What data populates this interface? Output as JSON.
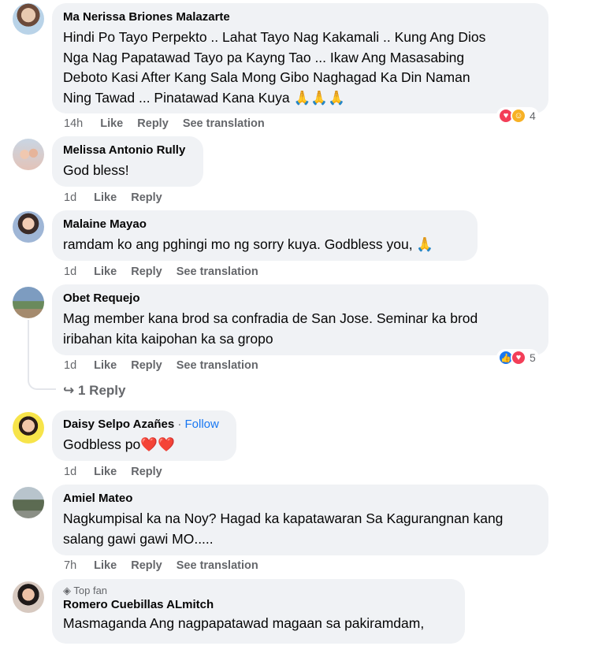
{
  "comments": [
    {
      "author": "Ma Nerissa Briones Malazarte",
      "lines": [
        "Hindi Po Tayo Perpekto .. Lahat Tayo Nag Kakamali .. Kung Ang Dios",
        "Nga Nag Papatawad Tayo pa Kayng Tao ... Ikaw Ang Masasabing",
        "Deboto Kasi After Kang Sala Mong Gibo Naghagad Ka Din Naman",
        "Ning Tawad ... Pinatawad Kana Kuya 🙏🙏🙏"
      ],
      "time": "14h",
      "like": "Like",
      "reply": "Reply",
      "translate": "See translation",
      "reaction_count": "4"
    },
    {
      "author": "Melissa Antonio Rully",
      "lines": [
        "God bless!"
      ],
      "time": "1d",
      "like": "Like",
      "reply": "Reply"
    },
    {
      "author": "Malaine Mayao",
      "lines": [
        "ramdam ko ang pghingi mo ng sorry kuya. Godbless you, 🙏"
      ],
      "time": "1d",
      "like": "Like",
      "reply": "Reply",
      "translate": "See translation"
    },
    {
      "author": "Obet Requejo",
      "lines": [
        "Mag member kana brod sa confradia de San Jose. Seminar ka brod",
        "iribahan kita kaipohan ka sa gropo"
      ],
      "time": "1d",
      "like": "Like",
      "reply": "Reply",
      "translate": "See translation",
      "reaction_count": "5",
      "replies_label": "1 Reply"
    },
    {
      "author": "Daisy Selpo Azañes",
      "follow_sep": " · ",
      "follow": "Follow",
      "lines": [
        "Godbless po❤️❤️"
      ],
      "time": "1d",
      "like": "Like",
      "reply": "Reply"
    },
    {
      "author": "Amiel Mateo",
      "lines": [
        "Nagkumpisal ka na Noy? Hagad ka kapatawaran Sa Kagurangnan kang",
        "salang gawi gawi MO....."
      ],
      "time": "7h",
      "like": "Like",
      "reply": "Reply",
      "translate": "See translation"
    },
    {
      "badge": "Top fan",
      "author": "Romero Cuebillas ALmitch",
      "lines": [
        "Masmaganda Ang nagpapatawad magaan sa pakiramdam,"
      ]
    }
  ],
  "icons": {
    "reply_arrow": "reply-arrow-icon",
    "love": "love-icon",
    "care": "care-icon",
    "like": "like-icon",
    "diamond": "diamond-icon"
  },
  "colors": {
    "bubble": "#f0f2f5",
    "meta": "#65676b",
    "link": "#1877f2",
    "love": "#f33e58",
    "like": "#1877f2",
    "care": "#f7b125"
  }
}
